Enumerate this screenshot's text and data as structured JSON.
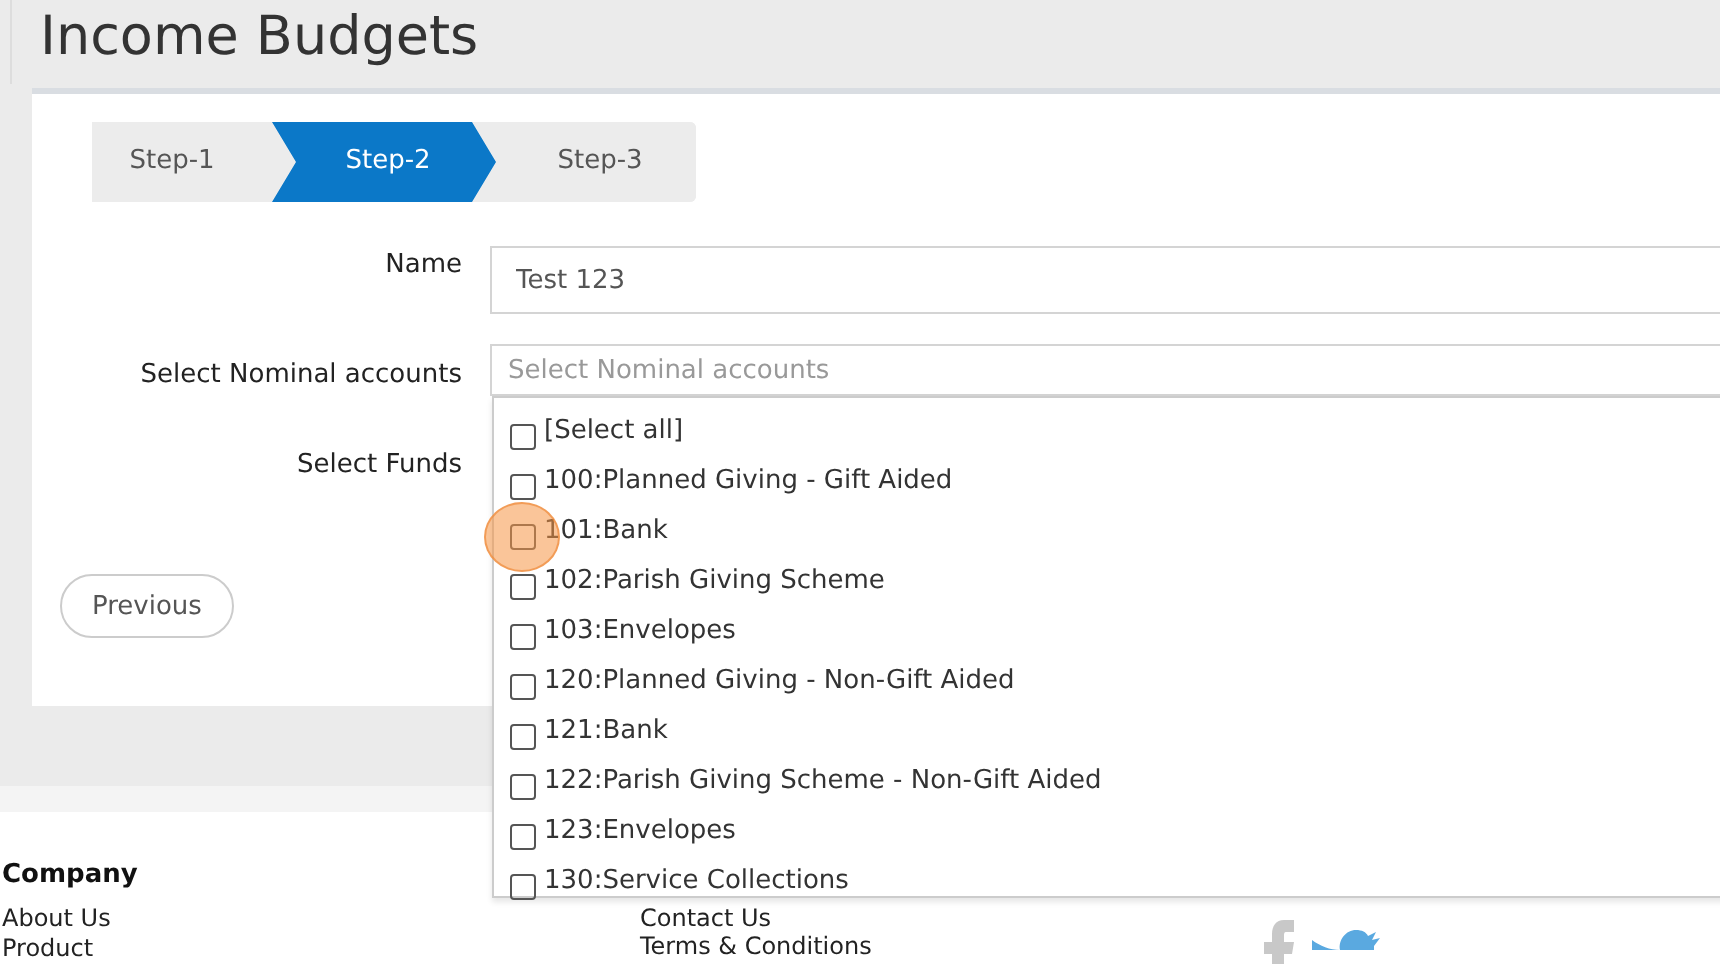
{
  "page_title": "Income Budgets",
  "steps": [
    {
      "label": "Step-1",
      "selected": false
    },
    {
      "label": "Step-2",
      "selected": true
    },
    {
      "label": "Step-3",
      "selected": false
    }
  ],
  "fields": [
    {
      "label": "Name",
      "value": "Test 123"
    },
    {
      "label": "Select Nominal accounts",
      "placeholder": "Select Nominal accounts"
    },
    {
      "label": "Select Funds"
    }
  ],
  "dropdown": {
    "options": [
      {
        "label": "[Select all]",
        "checked": false
      },
      {
        "label": "100:Planned Giving - Gift Aided",
        "checked": false
      },
      {
        "label": "101:Bank",
        "checked": false
      },
      {
        "label": "102:Parish Giving Scheme",
        "checked": false
      },
      {
        "label": "103:Envelopes",
        "checked": false
      },
      {
        "label": "120:Planned Giving - Non-Gift Aided",
        "checked": false
      },
      {
        "label": "121:Bank",
        "checked": false
      },
      {
        "label": "122:Parish Giving Scheme - Non-Gift Aided",
        "checked": false
      },
      {
        "label": "123:Envelopes",
        "checked": false
      },
      {
        "label": "130:Service Collections",
        "checked": false
      }
    ]
  },
  "previous_button": "Previous",
  "footer": {
    "heading": "Company",
    "column_1": [
      "About Us",
      "Product"
    ],
    "column_2": [
      "Contact Us",
      "Terms & Conditions"
    ]
  }
}
